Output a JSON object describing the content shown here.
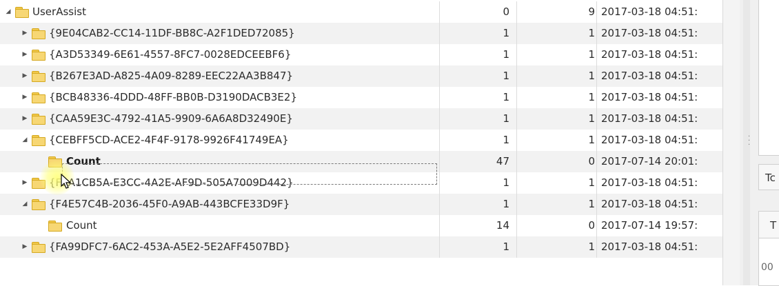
{
  "tree": {
    "rows": [
      {
        "name": "UserAssist",
        "col1": "0",
        "col2": "9",
        "date": "2017-03-18 04:51:",
        "level": 0,
        "arrow": "expanded"
      },
      {
        "name": "{9E04CAB2-CC14-11DF-BB8C-A2F1DED72085}",
        "col1": "1",
        "col2": "1",
        "date": "2017-03-18 04:51:",
        "level": 1,
        "arrow": "collapsed"
      },
      {
        "name": "{A3D53349-6E61-4557-8FC7-0028EDCEEBF6}",
        "col1": "1",
        "col2": "1",
        "date": "2017-03-18 04:51:",
        "level": 1,
        "arrow": "collapsed"
      },
      {
        "name": "{B267E3AD-A825-4A09-8289-EEC22AA3B847}",
        "col1": "1",
        "col2": "1",
        "date": "2017-03-18 04:51:",
        "level": 1,
        "arrow": "collapsed"
      },
      {
        "name": "{BCB48336-4DDD-48FF-BB0B-D3190DACB3E2}",
        "col1": "1",
        "col2": "1",
        "date": "2017-03-18 04:51:",
        "level": 1,
        "arrow": "collapsed"
      },
      {
        "name": "{CAA59E3C-4792-41A5-9909-6A6A8D32490E}",
        "col1": "1",
        "col2": "1",
        "date": "2017-03-18 04:51:",
        "level": 1,
        "arrow": "collapsed"
      },
      {
        "name": "{CEBFF5CD-ACE2-4F4F-9178-9926F41749EA}",
        "col1": "1",
        "col2": "1",
        "date": "2017-03-18 04:51:",
        "level": 1,
        "arrow": "expanded"
      },
      {
        "name": "Count",
        "col1": "47",
        "col2": "0",
        "date": "2017-07-14 20:01:",
        "level": 2,
        "arrow": "none",
        "selected": true
      },
      {
        "name": "{F2A1CB5A-E3CC-4A2E-AF9D-505A7009D442}",
        "col1": "1",
        "col2": "1",
        "date": "2017-03-18 04:51:",
        "level": 1,
        "arrow": "collapsed"
      },
      {
        "name": "{F4E57C4B-2036-45F0-A9AB-443BCFE33D9F}",
        "col1": "1",
        "col2": "1",
        "date": "2017-03-18 04:51:",
        "level": 1,
        "arrow": "expanded"
      },
      {
        "name": "Count",
        "col1": "14",
        "col2": "0",
        "date": "2017-07-14 19:57:",
        "level": 2,
        "arrow": "none"
      },
      {
        "name": "{FA99DFC7-6AC2-453A-A5E2-5E2AFF4507BD}",
        "col1": "1",
        "col2": "1",
        "date": "2017-03-18 04:51:",
        "level": 1,
        "arrow": "collapsed"
      }
    ]
  },
  "right_panel": {
    "tab1_label": "Tc",
    "tab2_label": "T",
    "value_fragment": "00"
  },
  "icons": {
    "expanded": "triangle-down-icon",
    "collapsed": "triangle-right-icon",
    "folder": "folder-icon"
  },
  "colors": {
    "folder": "#f7d774",
    "row_alt": "#f2f2f2"
  }
}
